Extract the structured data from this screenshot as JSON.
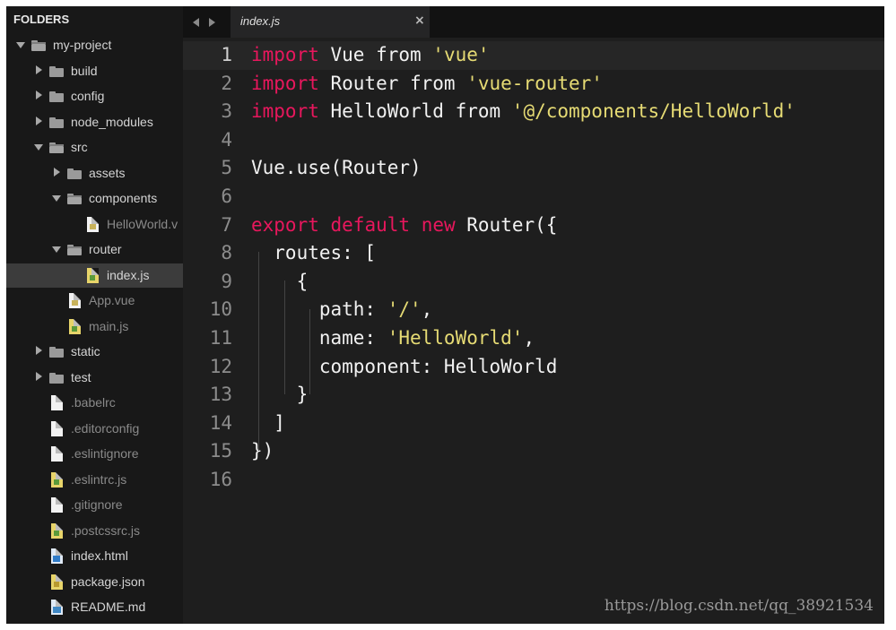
{
  "sidebar": {
    "title": "FOLDERS",
    "tree": [
      {
        "label": "my-project",
        "type": "folder",
        "open": true
      },
      {
        "label": "build",
        "type": "folder",
        "open": false
      },
      {
        "label": "config",
        "type": "folder",
        "open": false
      },
      {
        "label": "node_modules",
        "type": "folder",
        "open": false
      },
      {
        "label": "src",
        "type": "folder",
        "open": true
      },
      {
        "label": "assets",
        "type": "folder",
        "open": false
      },
      {
        "label": "components",
        "type": "folder",
        "open": true
      },
      {
        "label": "HelloWorld.v",
        "type": "file",
        "icon": "vue-file-icon"
      },
      {
        "label": "router",
        "type": "folder",
        "open": true
      },
      {
        "label": "index.js",
        "type": "file",
        "icon": "js-file-icon",
        "selected": true
      },
      {
        "label": "App.vue",
        "type": "file",
        "icon": "vue-file-icon"
      },
      {
        "label": "main.js",
        "type": "file",
        "icon": "js-file-icon"
      },
      {
        "label": "static",
        "type": "folder",
        "open": false
      },
      {
        "label": "test",
        "type": "folder",
        "open": false
      },
      {
        "label": ".babelrc",
        "type": "file",
        "icon": "file-icon"
      },
      {
        "label": ".editorconfig",
        "type": "file",
        "icon": "file-icon"
      },
      {
        "label": ".eslintignore",
        "type": "file",
        "icon": "file-icon"
      },
      {
        "label": ".eslintrc.js",
        "type": "file",
        "icon": "js-file-icon"
      },
      {
        "label": ".gitignore",
        "type": "file",
        "icon": "file-icon"
      },
      {
        "label": ".postcssrc.js",
        "type": "file",
        "icon": "js-file-icon"
      },
      {
        "label": "index.html",
        "type": "file",
        "icon": "html-file-icon"
      },
      {
        "label": "package.json",
        "type": "file",
        "icon": "json-file-icon"
      },
      {
        "label": "README.md",
        "type": "file",
        "icon": "markdown-file-icon"
      }
    ]
  },
  "tabs": {
    "active_title": "index.js",
    "close_glyph": "×",
    "nav_left_icon": "arrow-left-icon",
    "nav_right_icon": "arrow-right-icon"
  },
  "editor": {
    "current_line": 1,
    "colors": {
      "keyword": "#e8175d",
      "string": "#e6db74",
      "text": "#f1f1f1"
    },
    "lines": [
      "import Vue from 'vue'",
      "import Router from 'vue-router'",
      "import HelloWorld from '@/components/HelloWorld'",
      "",
      "Vue.use(Router)",
      "",
      "export default new Router({",
      "  routes: [",
      "    {",
      "      path: '/',",
      "      name: 'HelloWorld',",
      "      component: HelloWorld",
      "    }",
      "  ]",
      "})",
      ""
    ]
  },
  "watermark": "https://blog.csdn.net/qq_38921534"
}
